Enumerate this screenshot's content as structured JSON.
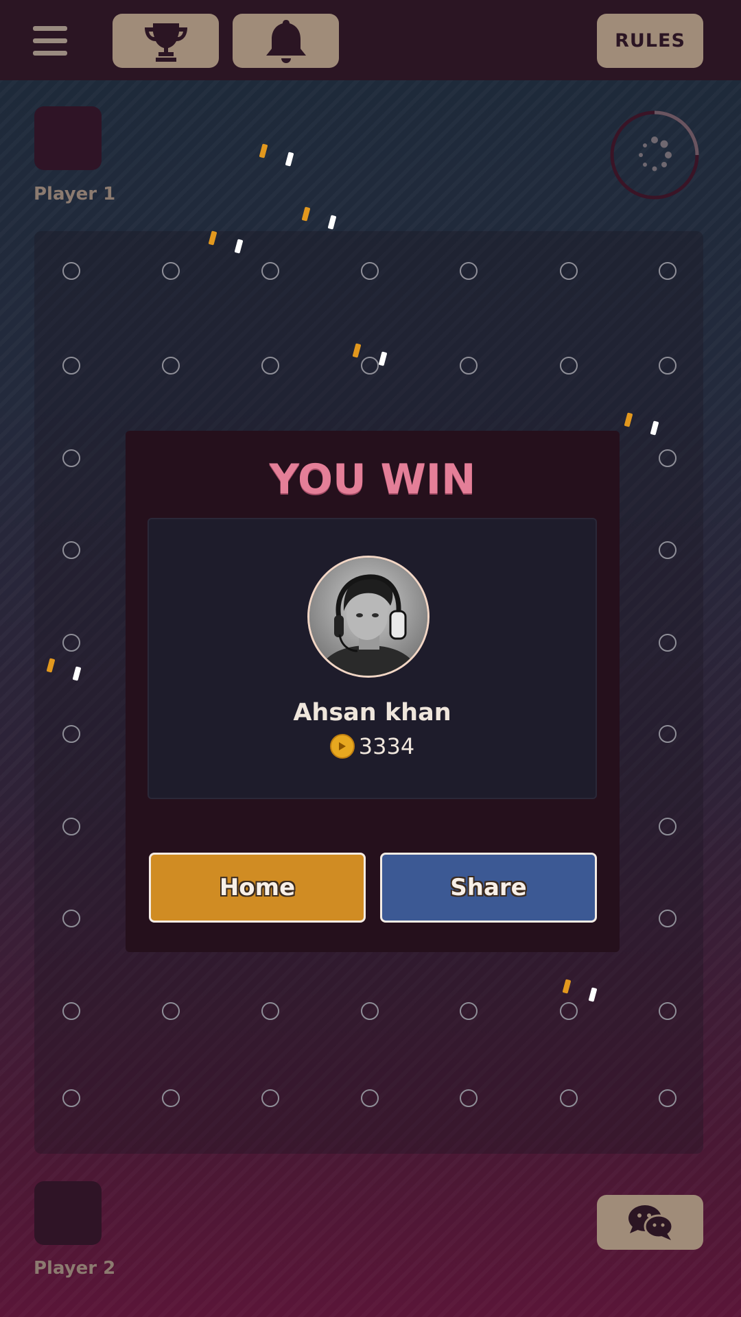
{
  "header": {
    "menu_icon": "hamburger-menu-icon",
    "trophy_icon": "trophy-icon",
    "bell_icon": "bell-icon",
    "rules_label": "RULES"
  },
  "players": {
    "top_label": "Player 1",
    "bottom_label": "Player 2"
  },
  "timer": {
    "icon": "loading-spinner-icon"
  },
  "board": {
    "peg_icon": "empty-peg-icon",
    "columns": 7,
    "rows": 10
  },
  "result_modal": {
    "title": "YOU WIN",
    "winner_name": "Ahsan khan",
    "coins": "3334",
    "coin_icon": "coin-icon",
    "home_label": "Home",
    "share_label": "Share"
  },
  "chat": {
    "icon": "chat-bubbles-icon"
  },
  "colors": {
    "topbar": "#2b1523",
    "button_tan": "#a08c79",
    "modal_bg": "#25101c",
    "title_pink": "#e47f98",
    "home_orange": "#d08c23",
    "share_blue": "#3c5994",
    "confetti_orange": "#e2981e",
    "confetti_white": "#ffffff"
  }
}
